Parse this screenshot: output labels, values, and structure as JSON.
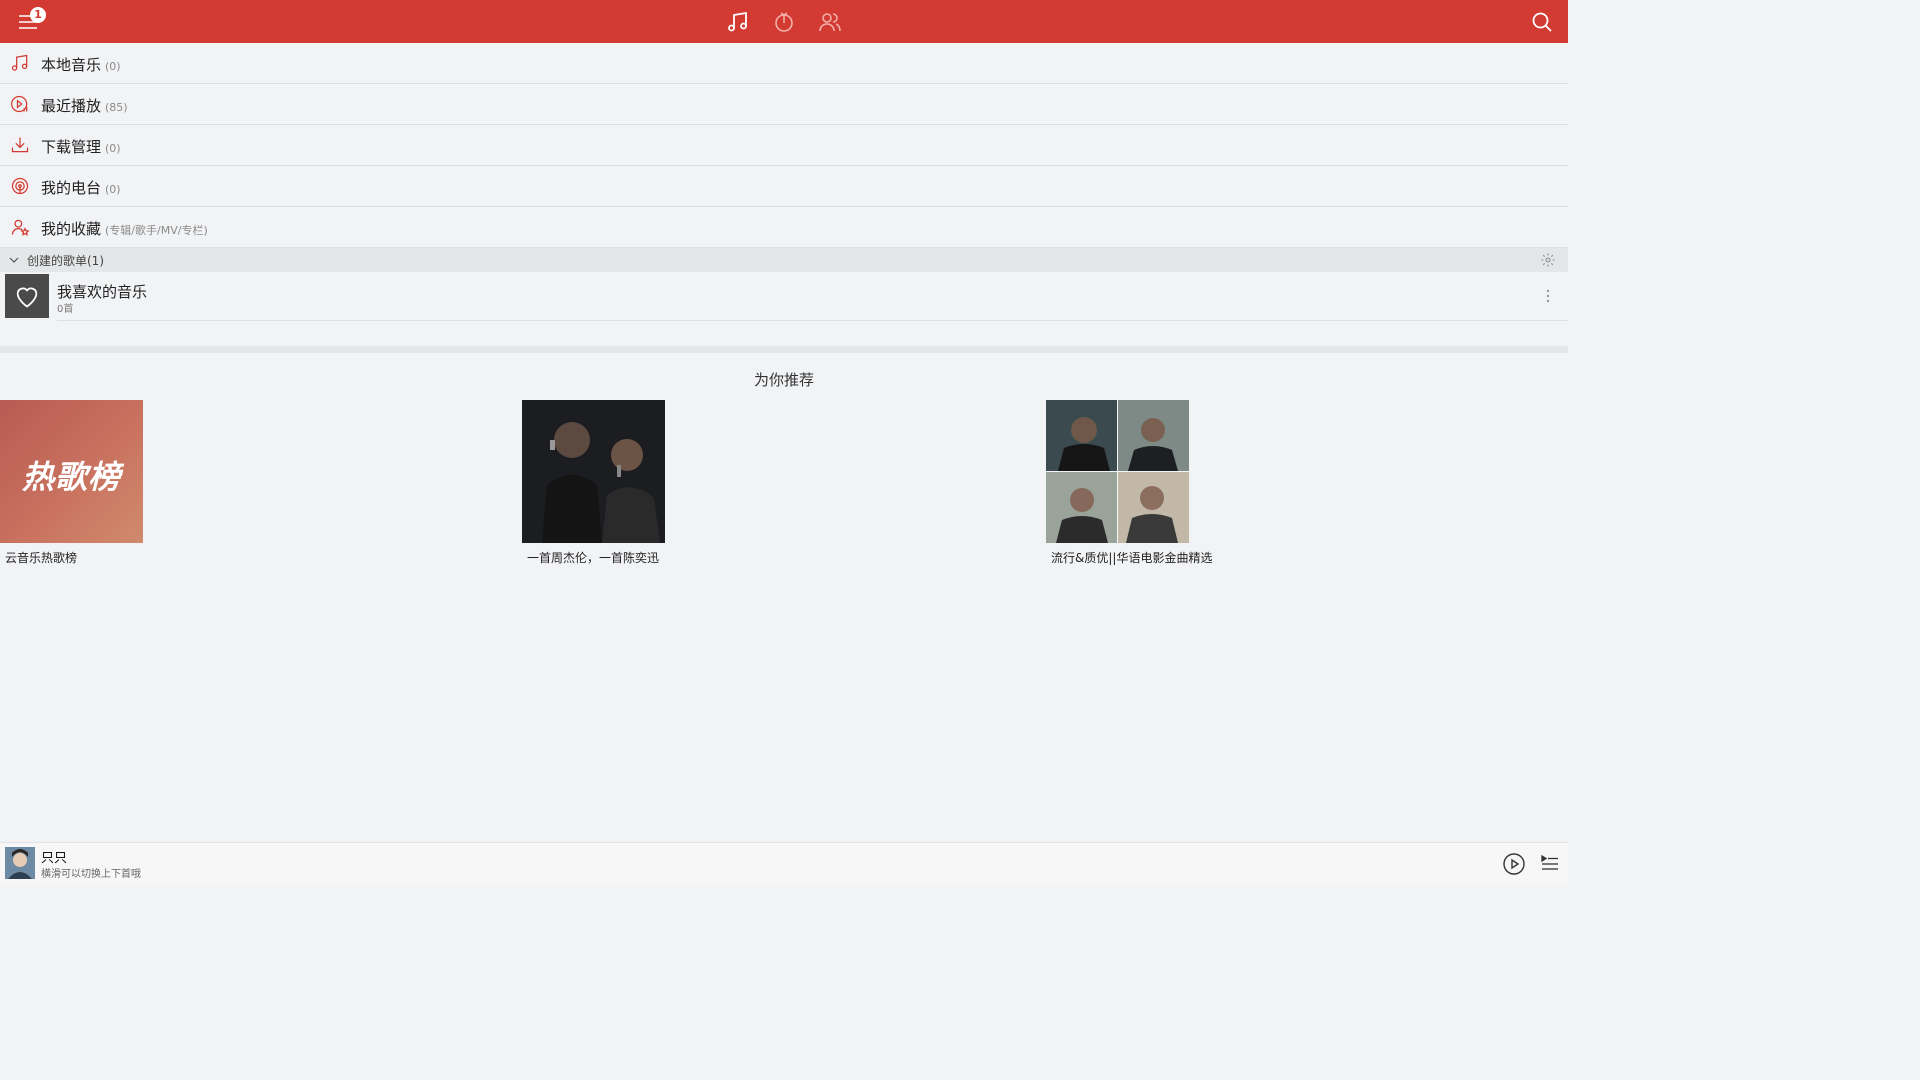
{
  "topbar": {
    "badge_count": "1",
    "accent_color": "#d33a31",
    "tabs": [
      {
        "icon": "music-note-icon",
        "active": true
      },
      {
        "icon": "radio-icon",
        "active": false
      },
      {
        "icon": "friends-icon",
        "active": false
      }
    ]
  },
  "menu": {
    "items": [
      {
        "label": "本地音乐",
        "count": "(0)",
        "icon": "music-note-icon"
      },
      {
        "label": "最近播放",
        "count": "(85)",
        "icon": "recent-play-icon"
      },
      {
        "label": "下载管理",
        "count": "(0)",
        "icon": "download-icon"
      },
      {
        "label": "我的电台",
        "count": "(0)",
        "icon": "radio-icon"
      },
      {
        "label": "我的收藏",
        "count": "(专辑/歌手/MV/专栏)",
        "icon": "collection-icon"
      }
    ]
  },
  "playlists": {
    "header": "创建的歌单(1)",
    "items": [
      {
        "name": "我喜欢的音乐",
        "sub": "0首"
      }
    ]
  },
  "recommend": {
    "title": "为你推荐",
    "cover_text": "热歌榜",
    "items": [
      {
        "caption": "云音乐热歌榜"
      },
      {
        "caption": "一首周杰伦，一首陈奕迅"
      },
      {
        "caption": "流行&质优||华语电影金曲精选"
      }
    ]
  },
  "player": {
    "song": "只只",
    "hint": "横滑可以切换上下首哦"
  }
}
